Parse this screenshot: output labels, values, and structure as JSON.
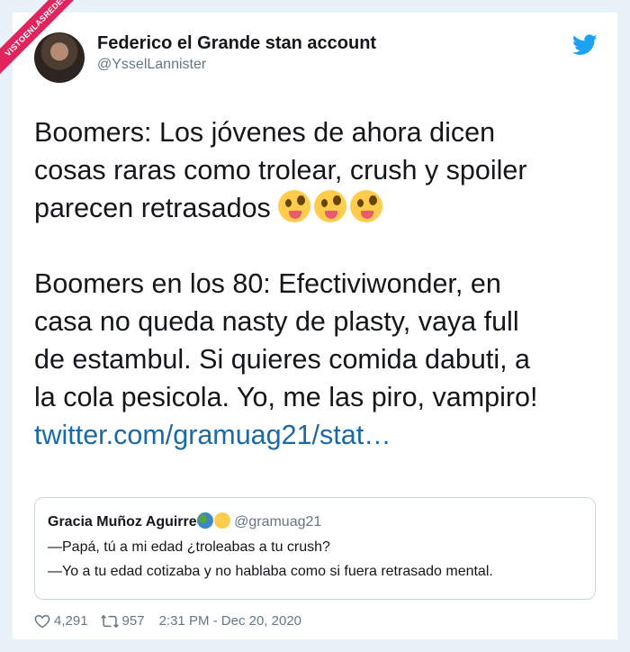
{
  "watermark": "VISTOENLASREDES",
  "author": {
    "name": "Federico el Grande stan account",
    "handle": "@YsselLannister"
  },
  "icons": {
    "brand": "twitter-bird-icon",
    "like": "heart-icon",
    "retweet": "retweet-icon"
  },
  "colors": {
    "brand": "#1da1f2",
    "link": "#1b6aa5",
    "text": "#14171a",
    "muted": "#657786",
    "background": "#e9f2f9"
  },
  "tweet": {
    "line1": "Boomers: Los jóvenes de ahora dicen",
    "line2": "cosas raras como trolear, crush y spoiler",
    "line3": "parecen retrasados",
    "line3_emoji": "zany-face-emoji",
    "line4": "Boomers en los 80: Efectiviwonder, en",
    "line5": "casa no queda nasty de plasty, vaya full",
    "line6": "de estambul. Si quieres comida dabuti, a",
    "line7": "la cola pesicola. Yo, me las piro, vampiro!",
    "link": "twitter.com/gramuag21/stat…"
  },
  "quoted": {
    "name": "Gracia Muñoz Aguirre",
    "emojis": [
      "globe-emoji",
      "sad-face-emoji"
    ],
    "handle": "@gramuag21",
    "line1": "—Papá, tú a mi edad ¿troleabas a tu crush?",
    "line2": "—Yo a tu edad cotizaba y no hablaba como si fuera retrasado mental."
  },
  "stats": {
    "likes": "4,291",
    "retweets": "957",
    "timestamp": "2:31 PM - Dec 20, 2020"
  }
}
